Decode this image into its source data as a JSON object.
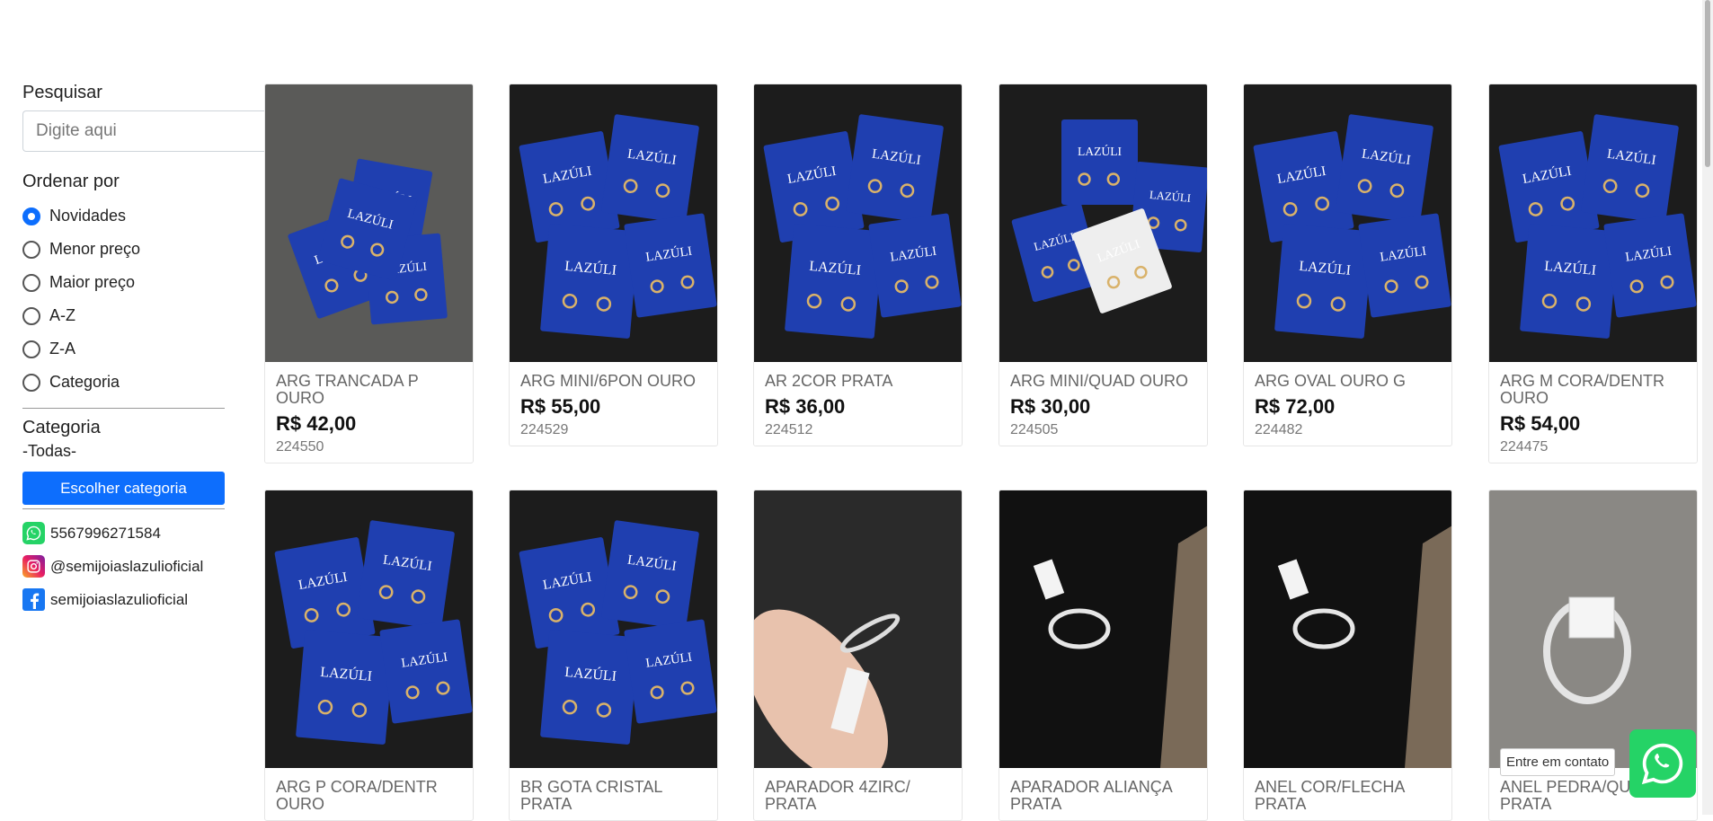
{
  "sidebar": {
    "search_title": "Pesquisar",
    "search_placeholder": "Digite aqui",
    "sort_title": "Ordenar por",
    "sort_options": [
      {
        "label": "Novidades",
        "selected": true
      },
      {
        "label": "Menor preço",
        "selected": false
      },
      {
        "label": "Maior preço",
        "selected": false
      },
      {
        "label": "A-Z",
        "selected": false
      },
      {
        "label": "Z-A",
        "selected": false
      },
      {
        "label": "Categoria",
        "selected": false
      }
    ],
    "category_title": "Categoria",
    "category_value": "-Todas-",
    "category_button": "Escolher categoria",
    "contacts": {
      "whatsapp": "5567996271584",
      "instagram": "@semijoiaslazulioficial",
      "facebook": "semijoiaslazulioficial"
    }
  },
  "products": [
    {
      "name": "ARG TRANCADA P OURO",
      "price": "R$ 42,00",
      "code": "224550",
      "image": "earrings-on-blue-cards-gray-background"
    },
    {
      "name": "ARG MINI/6PON OURO",
      "price": "R$ 55,00",
      "code": "224529",
      "image": "earrings-on-blue-cards-dark-background"
    },
    {
      "name": "AR 2COR PRATA",
      "price": "R$ 36,00",
      "code": "224512",
      "image": "earrings-on-blue-cards-dark-background"
    },
    {
      "name": "ARG MINI/QUAD OURO",
      "price": "R$ 30,00",
      "code": "224505",
      "image": "earrings-on-blue-and-white-cards"
    },
    {
      "name": "ARG OVAL OURO G",
      "price": "R$ 72,00",
      "code": "224482",
      "image": "hoop-earrings-on-blue-cards"
    },
    {
      "name": "ARG M CORA/DENTR OURO",
      "price": "R$ 54,00",
      "code": "224475",
      "image": "heart-earrings-on-blue-cards"
    },
    {
      "name": "ARG P CORA/DENTR OURO",
      "image": "heart-earrings-on-blue-cards"
    },
    {
      "name": "BR GOTA CRISTAL PRATA",
      "image": "stud-earrings-on-blue-cards"
    },
    {
      "name": "APARADOR 4ZIRC/ PRATA",
      "image": "ring-held-in-hand"
    },
    {
      "name": "APARADOR ALIANÇA PRATA",
      "image": "ring-on-black-display"
    },
    {
      "name": "ANEL COR/FLECHA PRATA",
      "image": "ring-on-black-display"
    },
    {
      "name": "ANEL PEDRA/QU PRATA",
      "image": "ring-on-gray-background"
    }
  ],
  "contact_tooltip": "Entre em contato",
  "colors": {
    "accent": "#0d6efd",
    "whatsapp": "#25d366",
    "card_blue": "#1f3fb0"
  }
}
